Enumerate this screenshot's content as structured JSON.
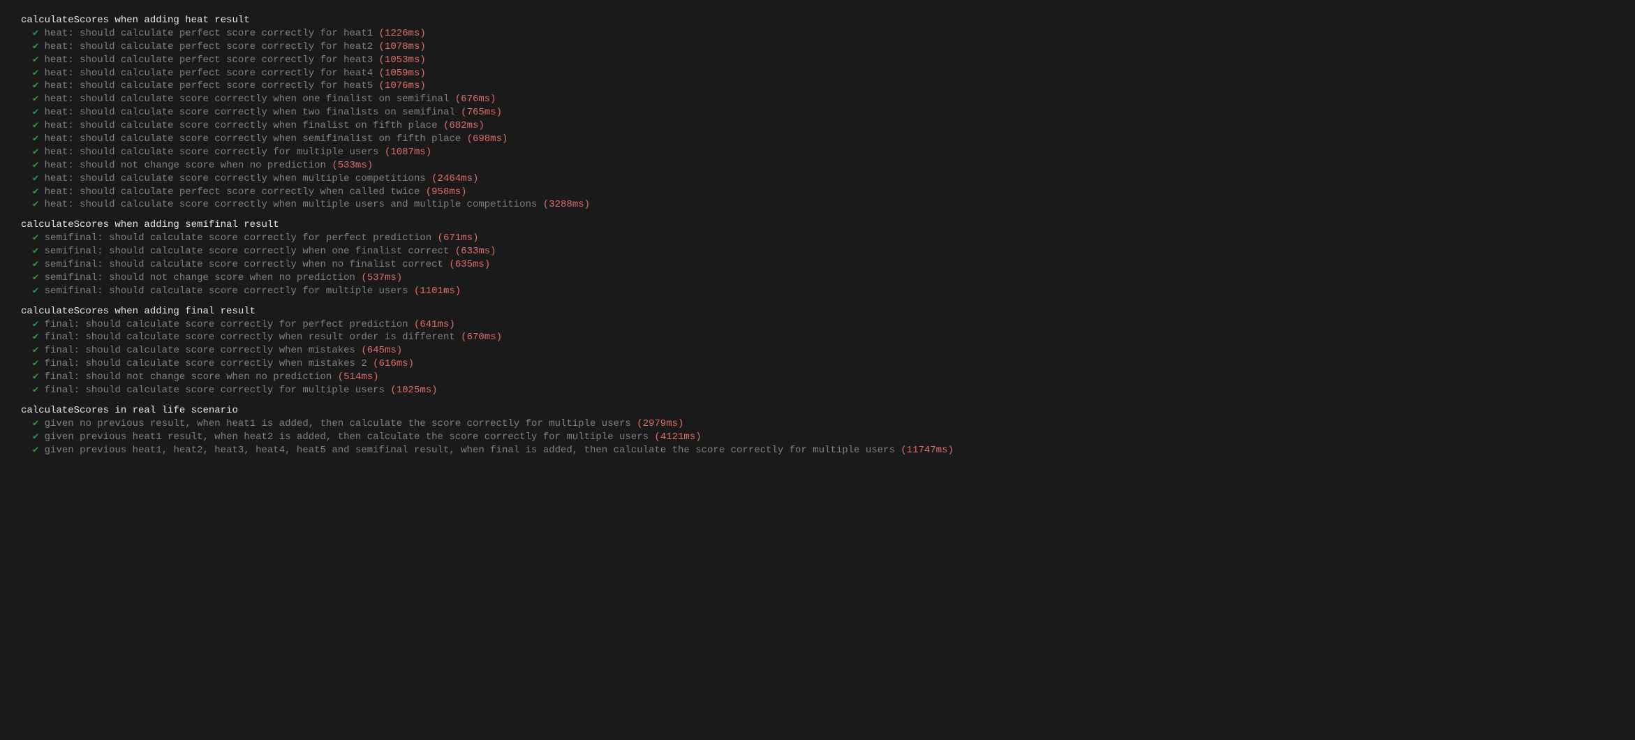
{
  "colors": {
    "bg": "#1a1a1a",
    "heading": "#e8e8e8",
    "text": "#808080",
    "check": "#2e9a4a",
    "timing": "#e06c6c"
  },
  "check_glyph": "✔",
  "suites": [
    {
      "title": "calculateScores when adding heat result",
      "tests": [
        {
          "name": "heat: should calculate perfect score correctly for heat1",
          "timing": "(1226ms)"
        },
        {
          "name": "heat: should calculate perfect score correctly for heat2",
          "timing": "(1078ms)"
        },
        {
          "name": "heat: should calculate perfect score correctly for heat3",
          "timing": "(1053ms)"
        },
        {
          "name": "heat: should calculate perfect score correctly for heat4",
          "timing": "(1059ms)"
        },
        {
          "name": "heat: should calculate perfect score correctly for heat5",
          "timing": "(1076ms)"
        },
        {
          "name": "heat: should calculate score correctly when one finalist on semifinal",
          "timing": "(676ms)"
        },
        {
          "name": "heat: should calculate score correctly when two finalists on semifinal",
          "timing": "(765ms)"
        },
        {
          "name": "heat: should calculate score correctly when finalist on fifth place",
          "timing": "(682ms)"
        },
        {
          "name": "heat: should calculate score correctly when semifinalist on fifth place",
          "timing": "(698ms)"
        },
        {
          "name": "heat: should calculate score correctly for multiple users",
          "timing": "(1087ms)"
        },
        {
          "name": "heat: should not change score when no prediction",
          "timing": "(533ms)"
        },
        {
          "name": "heat: should calculate score correctly when multiple competitions",
          "timing": "(2464ms)"
        },
        {
          "name": "heat: should calculate perfect score correctly when called twice",
          "timing": "(958ms)"
        },
        {
          "name": "heat: should calculate score correctly when multiple users and multiple competitions",
          "timing": "(3288ms)"
        }
      ]
    },
    {
      "title": "calculateScores when adding semifinal result",
      "tests": [
        {
          "name": "semifinal: should calculate score correctly for perfect prediction",
          "timing": "(671ms)"
        },
        {
          "name": "semifinal: should calculate score correctly when one finalist correct",
          "timing": "(633ms)"
        },
        {
          "name": "semifinal: should calculate score correctly when no finalist correct",
          "timing": "(635ms)"
        },
        {
          "name": "semifinal: should not change score when no prediction",
          "timing": "(537ms)"
        },
        {
          "name": "semifinal: should calculate score correctly for multiple users",
          "timing": "(1101ms)"
        }
      ]
    },
    {
      "title": "calculateScores when adding final result",
      "tests": [
        {
          "name": "final: should calculate score correctly for perfect prediction",
          "timing": "(641ms)"
        },
        {
          "name": "final: should calculate score correctly when result order is different",
          "timing": "(670ms)"
        },
        {
          "name": "final: should calculate score correctly when mistakes",
          "timing": "(645ms)"
        },
        {
          "name": "final: should calculate score correctly when mistakes 2",
          "timing": "(616ms)"
        },
        {
          "name": "final: should not change score when no prediction",
          "timing": "(514ms)"
        },
        {
          "name": "final: should calculate score correctly for multiple users",
          "timing": "(1025ms)"
        }
      ]
    },
    {
      "title": "calculateScores in real life scenario",
      "tests": [
        {
          "name": "given no previous result, when heat1 is added, then calculate the score correctly for multiple users",
          "timing": "(2979ms)"
        },
        {
          "name": "given previous heat1 result, when heat2 is added, then calculate the score correctly for multiple users",
          "timing": "(4121ms)"
        },
        {
          "name": "given previous heat1, heat2, heat3, heat4, heat5 and semifinal result, when final is added, then calculate the score correctly for multiple users",
          "timing": "(11747ms)"
        }
      ]
    }
  ]
}
